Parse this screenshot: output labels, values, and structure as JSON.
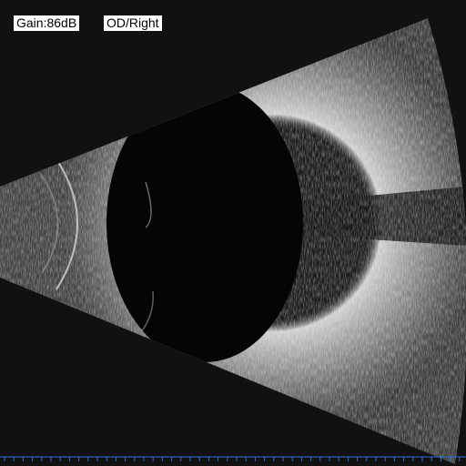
{
  "overlay": {
    "gain": "Gain:86dB",
    "eye": "OD/Right"
  },
  "colors": {
    "background": "#111111",
    "label_background": "#ffffff",
    "label_text": "#000000",
    "scale": "#2a6fd6"
  }
}
